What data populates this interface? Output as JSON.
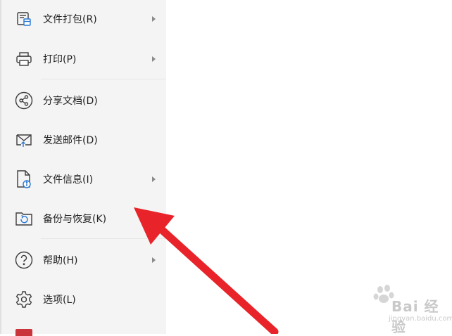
{
  "menu": {
    "items": [
      {
        "label": "文件打包(R)",
        "icon": "package-icon",
        "submenu": true
      },
      {
        "label": "打印(P)",
        "icon": "printer-icon",
        "submenu": true
      },
      {
        "label": "分享文档(D)",
        "icon": "share-icon",
        "submenu": false
      },
      {
        "label": "发送邮件(D)",
        "icon": "mail-icon",
        "submenu": false
      },
      {
        "label": "文件信息(I)",
        "icon": "file-info-icon",
        "submenu": true
      },
      {
        "label": "备份与恢复(K)",
        "icon": "backup-restore-icon",
        "submenu": false
      },
      {
        "label": "帮助(H)",
        "icon": "help-icon",
        "submenu": true
      },
      {
        "label": "选项(L)",
        "icon": "gear-icon",
        "submenu": false
      }
    ]
  },
  "watermark": {
    "text": "Bai 经验",
    "sub": "jingyan.baidu.com"
  },
  "colors": {
    "menu_bg": "#f4f4f4",
    "icon_stroke": "#3c3c3c",
    "accent_blue": "#2a78d2",
    "arrow_red": "#e8242a"
  }
}
